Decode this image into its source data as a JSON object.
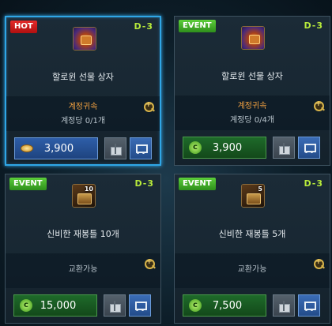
{
  "cards": [
    {
      "badge": "HOT",
      "dday": "D-3",
      "name": "할로윈 선물 상자",
      "account_bound": "계정귀속",
      "limit": "계정당 0/1개",
      "price": "3,900",
      "currency_icon": "gold-coin-icon",
      "selected": true
    },
    {
      "badge": "EVENT",
      "dday": "D-3",
      "name": "할로윈 선물 상자",
      "account_bound": "계정귀속",
      "limit": "계정당 0/4개",
      "price": "3,900",
      "currency_icon": "green-coin-icon"
    },
    {
      "badge": "EVENT",
      "dday": "D-3",
      "name": "신비한 재봉틀 10개",
      "icon_qty": "10",
      "exchange": "교환가능",
      "price": "15,000",
      "currency_icon": "green-coin-icon"
    },
    {
      "badge": "EVENT",
      "dday": "D-3",
      "name": "신비한 재봉틀 5개",
      "icon_qty": "5",
      "exchange": "교환가능",
      "price": "7,500",
      "currency_icon": "green-coin-icon"
    }
  ],
  "colors": {
    "selected_border": "#2fa6e6",
    "hot_badge": "#d61c1c",
    "event_badge": "#43b02a",
    "dday": "#b7ea3b",
    "account_bound": "#f0a040"
  },
  "green_coin_glyph": "c"
}
